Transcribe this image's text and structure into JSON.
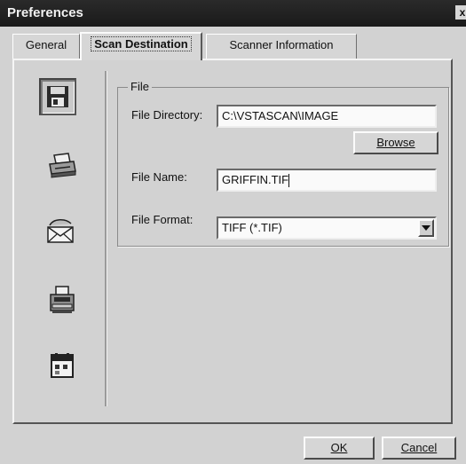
{
  "window": {
    "title": "Preferences",
    "close_glyph": "x"
  },
  "tabs": [
    {
      "label": "General"
    },
    {
      "label": "Scan Destination"
    },
    {
      "label": "Scanner Information"
    }
  ],
  "destinations": [
    {
      "icon": "disk-icon",
      "selected": true
    },
    {
      "icon": "printer-icon",
      "selected": false
    },
    {
      "icon": "mail-icon",
      "selected": false
    },
    {
      "icon": "fax-icon",
      "selected": false
    },
    {
      "icon": "calendar-icon",
      "selected": false
    }
  ],
  "file_group": {
    "legend": "File",
    "directory_label": "File Directory:",
    "directory_value": "C:\\VSTASCAN\\IMAGE",
    "browse_label": "Browse",
    "name_label": "File Name:",
    "name_value": "GRIFFIN.TIF",
    "format_label": "File Format:",
    "format_value": "TIFF (*.TIF)"
  },
  "buttons": {
    "ok_label": "OK",
    "cancel_label": "Cancel"
  }
}
